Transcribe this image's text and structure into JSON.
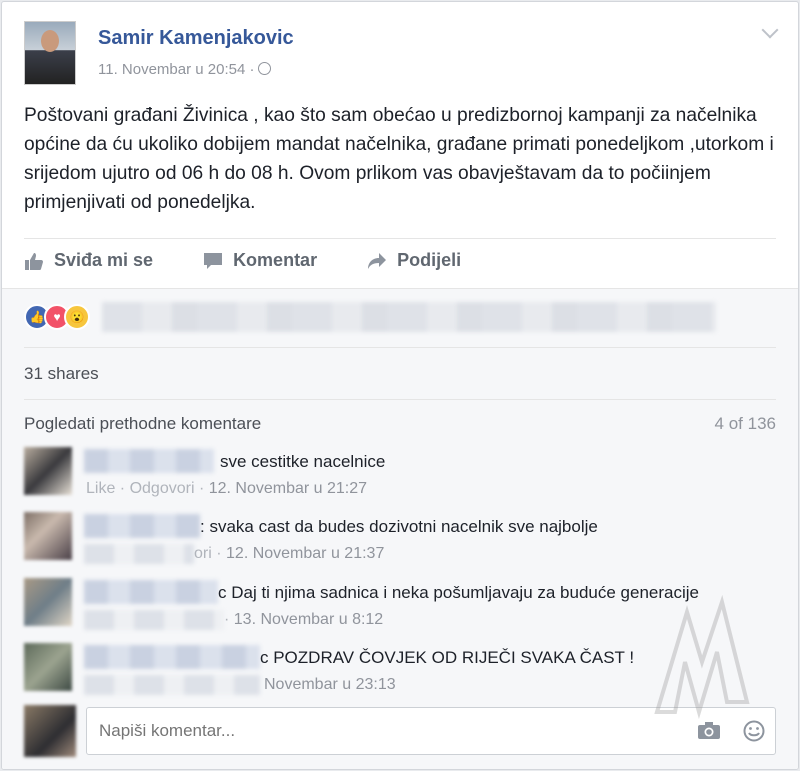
{
  "post": {
    "author": "Samir Kamenjakovic",
    "timestamp": "11. Novembar u 20:54 ·",
    "text": "Poštovani građani Živinica , kao što sam obećao u predizbornoj kampanji za načelnika općine da ću ukoliko dobijem mandat načelnika, građane primati ponedeljkom ,utorkom i srijedom ujutro od 06 h do 08 h. Ovom prlikom vas obavještavam da to počiinjem primjenjivati od ponedeljka."
  },
  "actions": {
    "like": "Sviđa mi se",
    "comment": "Komentar",
    "share": "Podijeli"
  },
  "reactions": [
    "like",
    "love",
    "wow"
  ],
  "shares": "31 shares",
  "comments_header": {
    "previous": "Pogledati prethodne komentare",
    "count": "4 of 136"
  },
  "comments": [
    {
      "text": "sve cestitke nacelnice",
      "meta_prefix": "Like · Odgovori ·",
      "time": "12. Novembar u 21:27"
    },
    {
      "text": ": svaka cast da budes dozivotni nacelnik sve najbolje",
      "meta_prefix": "ori ·",
      "time": "12. Novembar u 21:37"
    },
    {
      "text": "c Daj ti njima sadnica i neka pošumljavaju za buduće generacije",
      "meta_prefix": "·",
      "time": "13. Novembar u 8:12"
    },
    {
      "text": "c POZDRAV ČOVJEK OD RIJEČI SVAKA ČAST !",
      "meta_prefix": "",
      "time": "Novembar u 23:13"
    }
  ],
  "composer": {
    "placeholder": "Napiši komentar..."
  },
  "colors": {
    "link": "#365899",
    "meta": "#90949c",
    "text": "#1d2129"
  }
}
